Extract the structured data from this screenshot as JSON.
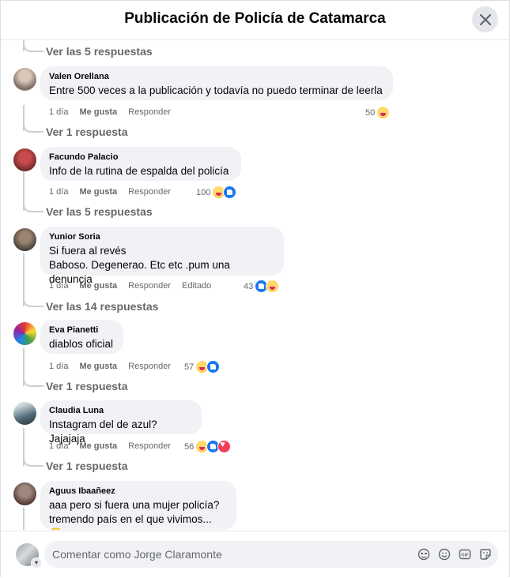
{
  "header": {
    "title": "Publicación de Policía de Catamarca"
  },
  "comments": [
    {
      "author": "Valen Orellana",
      "lines": [
        "Entre 500 veces a la publicación y todavía no puedo terminar de leerla"
      ],
      "time": "1 día",
      "like_label": "Me gusta",
      "reply_label": "Responder",
      "edited": "",
      "reaction_count": "50",
      "reactions": [
        "haha"
      ],
      "replies_link": "Ver 1 respuesta"
    },
    {
      "author": "Facundo Palacio",
      "lines": [
        "Info de la rutina de espalda del policía"
      ],
      "time": "1 día",
      "like_label": "Me gusta",
      "reply_label": "Responder",
      "edited": "",
      "reaction_count": "100",
      "reactions": [
        "haha",
        "like"
      ],
      "replies_link": "Ver las 5 respuestas"
    },
    {
      "author": "Yunior Soria",
      "lines": [
        "Si fuera al revés",
        "Baboso. Degenerao. Etc etc .pum una denuncia"
      ],
      "time": "1 día",
      "like_label": "Me gusta",
      "reply_label": "Responder",
      "edited": "Editado",
      "reaction_count": "43",
      "reactions": [
        "like",
        "haha"
      ],
      "replies_link": "Ver las 14 respuestas"
    },
    {
      "author": "Eva Pianetti",
      "lines": [
        "diablos oficial"
      ],
      "time": "1 día",
      "like_label": "Me gusta",
      "reply_label": "Responder",
      "edited": "",
      "reaction_count": "57",
      "reactions": [
        "haha",
        "like"
      ],
      "replies_link": "Ver 1 respuesta"
    },
    {
      "author": "Claudia Luna",
      "lines": [
        "Instagram del de azul? Jajajaja"
      ],
      "time": "1 día",
      "like_label": "Me gusta",
      "reply_label": "Responder",
      "edited": "",
      "reaction_count": "56",
      "reactions": [
        "haha",
        "like",
        "love"
      ],
      "replies_link": "Ver 1 respuesta"
    },
    {
      "author": "Aguus Ibaañeez",
      "lines": [
        "aaa pero si fuera una mujer policía?",
        "tremendo país en el que vivimos... 😔"
      ],
      "time": "",
      "like_label": "",
      "reply_label": "",
      "edited": "",
      "reaction_count": "",
      "reactions": [],
      "replies_link": ""
    }
  ],
  "top_replies_link": "Ver las 5 respuestas",
  "composer": {
    "placeholder": "Comentar como Jorge Claramonte"
  },
  "icons": {
    "close": "close-icon",
    "composer_tools": [
      "avatar-sticker-icon",
      "emoji-icon",
      "gif-icon",
      "sticker-icon"
    ]
  },
  "colors": {
    "bubble": "#f0f2f5",
    "muted": "#65676b",
    "like": "#1877f2",
    "love": "#f33e58",
    "haha": "#f7b125"
  }
}
